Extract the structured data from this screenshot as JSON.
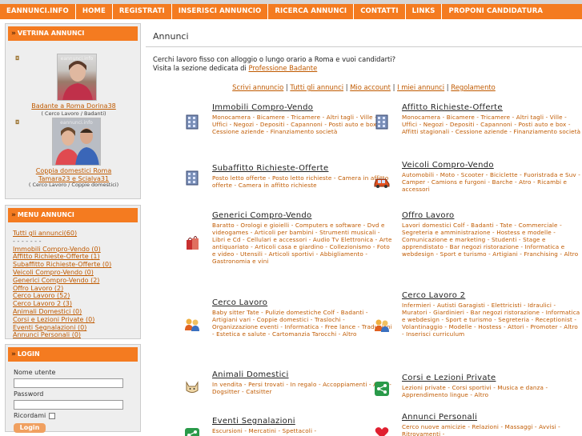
{
  "nav": [
    "EANNUNCI.INFO",
    "HOME",
    "REGISTRATI",
    "INSERISCI ANNUNCIO",
    "RICERCA ANNUNCI",
    "CONTATTI",
    "LINKS",
    "PROPONI CANDIDATURA"
  ],
  "vetrina": {
    "title": "VETRINA ANNUNCI",
    "items": [
      {
        "link": "Badante a Roma Dorina38",
        "sub": "( Cerco Lavoro / Badanti)",
        "watermark": "eannunci.info"
      },
      {
        "link": "Coppia domestici Roma Tamara23 e Scialva31",
        "link_lines": [
          "Coppia domestici Roma",
          "Tamara23 e Scialva31"
        ],
        "sub": "( Cerco Lavoro / Coppie domestici)",
        "watermark": "eannunci.info"
      }
    ]
  },
  "menu": {
    "title": "MENU ANNUNCI",
    "all": "Tutti gli annunci(60)",
    "dots": "- - - - - - -",
    "items": [
      "Immobili Compro-Vendo (0)",
      "Affitto Richieste-Offerte (1)",
      "Subaffitto Richieste-Offerte (0)",
      "Veicoli Compro-Vendo (0)",
      "Generici Compro-Vendo (2)",
      "Offro Lavoro (2)",
      "Cerco Lavoro (52)",
      "Cerco Lavoro 2 (3)",
      "Animali Domestici (0)",
      "Corsi e Lezioni Private (0)",
      "Eventi Segnalazioni (0)",
      "Annunci Personali (0)"
    ]
  },
  "login": {
    "title": "LOGIN",
    "username_label": "Nome utente",
    "password_label": "Password",
    "remember_label": "Ricordami",
    "button": "Login"
  },
  "main": {
    "title": "Annunci",
    "intro_line1": "Cerchi lavoro fisso con alloggio o lungo orario a Roma e vuoi candidarti?",
    "intro_line2_prefix": "Visita la sezione dedicata di ",
    "intro_link": "Professione Badante",
    "actions": [
      "Scrivi annuncio",
      "Tutti gli annunci",
      "Mio account",
      "I miei annunci",
      "Regolamento"
    ],
    "categories": [
      {
        "title": "Immobili Compro-Vendo",
        "subs": "Monocamera - Bicamere - Tricamere - Altri tagli - Ville - Uffici - Negozi - Depositi - Capannoni - Posti auto e box - Cessione aziende - Finanziamento società",
        "icon": "building-icon"
      },
      {
        "title": "Affitto Richieste-Offerte",
        "subs": "Monocamera - Bicamere - Tricamere - Altri tagli - Ville - Uffici - Negozi - Depositi - Capannoni - Posti auto e box - Affitti stagionali - Cessione aziende - Finanziamento società",
        "icon": "building-icon"
      },
      {
        "title": "Subaffitto Richieste-Offerte",
        "subs": "Posto letto offerte - Posto letto richieste - Camera in affitto offerte - Camera in affitto richieste",
        "icon": "building-icon"
      },
      {
        "title": "Veicoli Compro-Vendo",
        "subs": "Automobili - Moto - Scooter - Biciclette - Fuoristrada e Suv - Camper - Camions e furgoni - Barche - Atro - Ricambi e accessori",
        "icon": "car-icon"
      },
      {
        "title": "Generici Compro-Vendo",
        "subs": "Baratto - Orologi e gioielli - Computers e software - Dvd e videogames - Articoli per bambini - Strumenti musicali - Libri e Cd - Cellulari e accessori - Audio Tv Elettronica - Arte antiquariato - Articoli casa e giardino - Collezionismo - Foto e video - Utensili - Articoli sportivi - Abbigliamento - Gastronomia e vini",
        "icon": "shopping-icon"
      },
      {
        "title": "Offro Lavoro",
        "subs": "Lavori domestici Colf - Badanti - Tate - Commerciale - Segreteria e amministrazione - Hostess e modelle - Comunicazione e marketing - Studenti - Stage e apprendistato - Bar negozi ristorazione - Informatica e webdesign - Sport e turismo - Artigiani - Franchising - Altro",
        "icon": ""
      },
      {
        "title": "Cerco Lavoro",
        "subs": "Baby sitter Tate - Pulizie domestiche Colf - Badanti - Artigiani vari - Coppie domestici - Traslochi - Organizzazione eventi - Informatica - Free lance - Traduzioni - Estetica e salute - Cartomanzia Tarocchi - Altro",
        "icon": "people-icon"
      },
      {
        "title": "Cerco Lavoro 2",
        "subs": "Infermieri - Autisti Garagisti - Elettricisti - Idraulici - Muratori - Giardinieri - Bar negozi ristorazione - Informatica e webdesign - Sport e turismo - Segreteria - Receptionist - Volantinaggio - Modelle - Hostess - Attori - Promoter - Altro - Inserisci curriculum",
        "icon": "people-icon"
      },
      {
        "title": "Animali Domestici",
        "subs": "In vendita - Persi trovati - In regalo - Accoppiamenti - Altro - Dogsitter - Catsitter",
        "icon": "cat-icon"
      },
      {
        "title": "Corsi e Lezioni Private",
        "subs": "Lezioni private - Corsi sportivi - Musica e danza - Apprendimento lingue - Altro",
        "icon": "share-icon"
      },
      {
        "title": "Eventi Segnalazioni",
        "subs": "Escursioni - Mercatini - Spettacoli -",
        "icon": "share-icon"
      },
      {
        "title": "Annunci Personali",
        "subs": "Cerco nuove amicizie - Relazioni - Massaggi - Avvisi - Ritrovamenti -",
        "icon": "heart-icon"
      }
    ]
  },
  "colors": {
    "accent": "#f47b20",
    "link": "#c05a00",
    "sidebar_bg": "#eeeeee"
  }
}
